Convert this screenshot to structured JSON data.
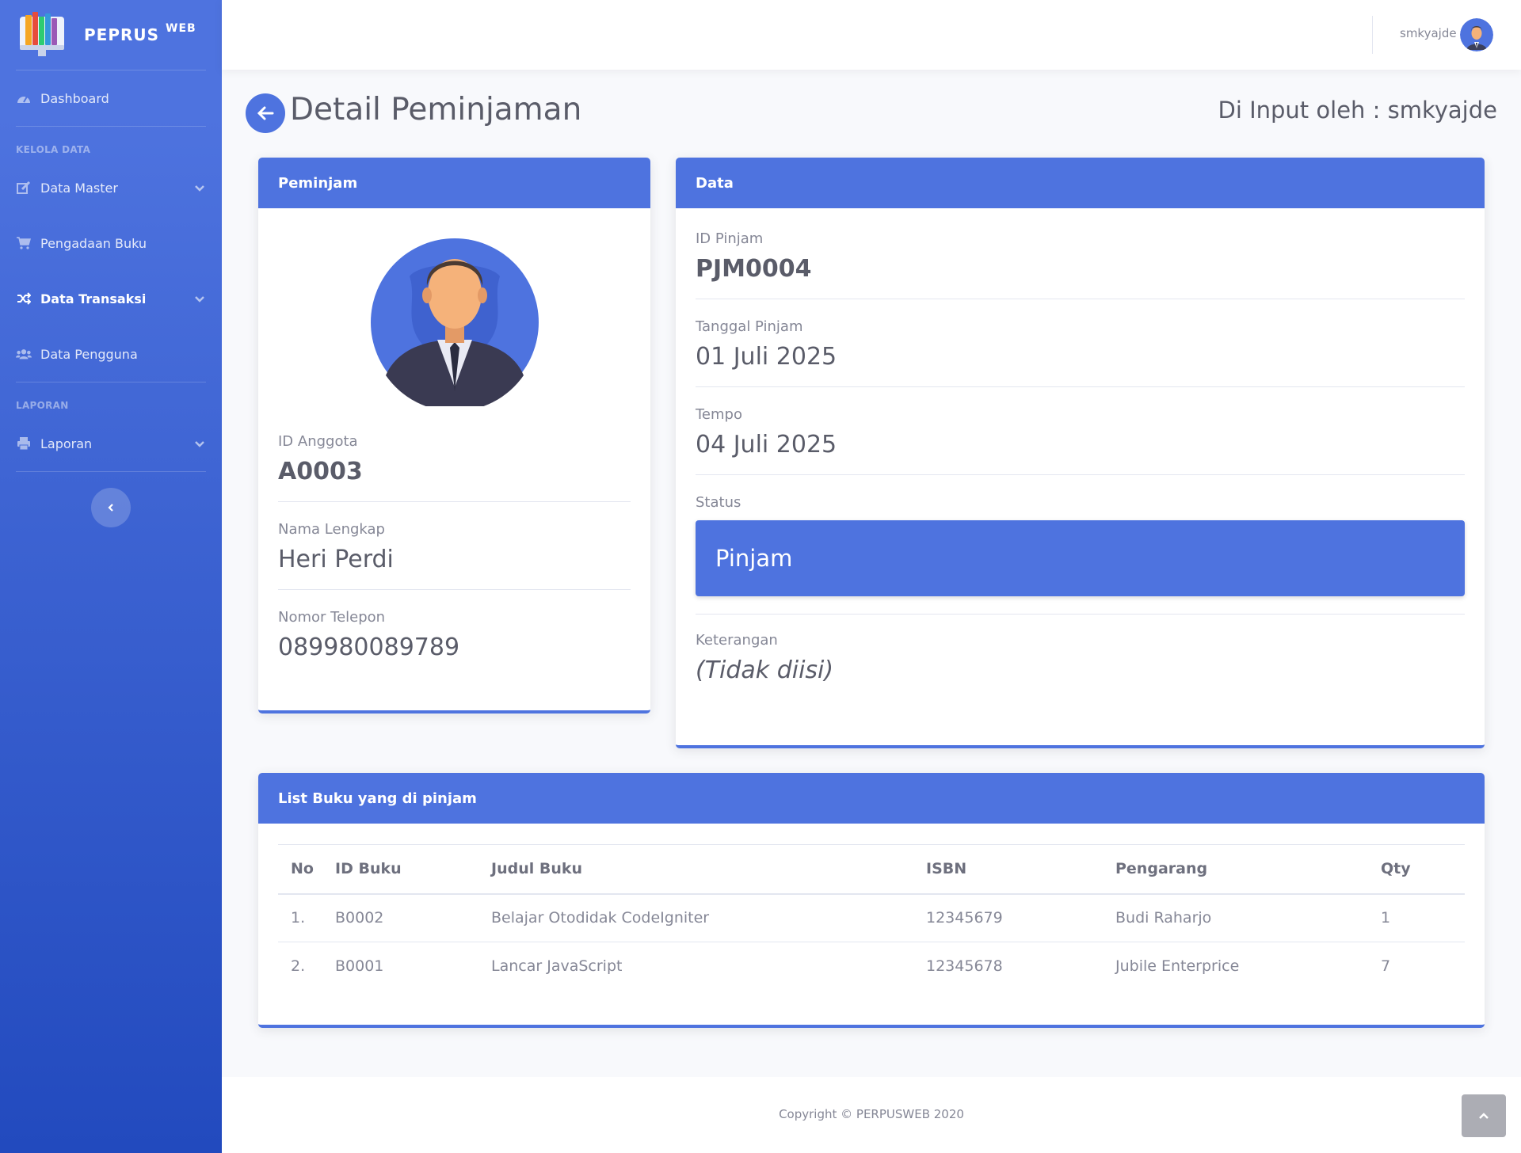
{
  "brand": {
    "name": "PEPRUS",
    "suffix": "WEB"
  },
  "sidebar": {
    "items": [
      {
        "label": "Dashboard"
      },
      {
        "heading": "KELOLA DATA"
      },
      {
        "label": "Data Master"
      },
      {
        "label": "Pengadaan Buku"
      },
      {
        "label": "Data Transaksi"
      },
      {
        "label": "Data Pengguna"
      },
      {
        "heading": "LAPORAN"
      },
      {
        "label": "Laporan"
      }
    ]
  },
  "topbar": {
    "username": "smkyajde"
  },
  "page": {
    "title": "Detail Peminjaman",
    "input_by": "Di Input oleh : smkyajde"
  },
  "borrower_card": {
    "header": "Peminjam",
    "fields": [
      {
        "label": "ID Anggota",
        "value": "A0003"
      },
      {
        "label": "Nama Lengkap",
        "value": "Heri Perdi"
      },
      {
        "label": "Nomor Telepon",
        "value": "089980089789"
      }
    ]
  },
  "data_card": {
    "header": "Data",
    "fields": [
      {
        "label": "ID Pinjam",
        "value": "PJM0004"
      },
      {
        "label": "Tanggal Pinjam",
        "value": "01 Juli 2025"
      },
      {
        "label": "Tempo",
        "value": "04 Juli 2025"
      },
      {
        "label": "Status",
        "value": "Pinjam"
      },
      {
        "label": "Keterangan",
        "value": "(Tidak diisi)"
      }
    ]
  },
  "books_card": {
    "header": "List Buku yang di pinjam",
    "columns": [
      "No",
      "ID Buku",
      "Judul Buku",
      "ISBN",
      "Pengarang",
      "Qty"
    ],
    "rows": [
      [
        "1.",
        "B0002",
        "Belajar Otodidak CodeIgniter",
        "12345679",
        "Budi Raharjo",
        "1"
      ],
      [
        "2.",
        "B0001",
        "Lancar JavaScript",
        "12345678",
        "Jubile Enterprice",
        "7"
      ]
    ]
  },
  "footer": {
    "copyright": "Copyright © PERPUSWEB 2020"
  },
  "colors": {
    "primary": "#4e73df",
    "sidebar_bottom": "#224abe",
    "text": "#858796",
    "heading": "#5a5c69"
  }
}
